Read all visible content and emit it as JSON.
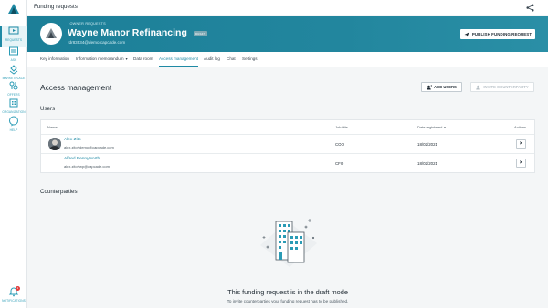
{
  "topbar": {
    "title": "Funding requests"
  },
  "sidebar": {
    "items": [
      {
        "label": "Requests",
        "icon": "requests-icon",
        "active": true
      },
      {
        "label": "Ask",
        "icon": "ask-icon"
      },
      {
        "label": "Marketplace",
        "icon": "marketplace-icon"
      },
      {
        "label": "Offers",
        "icon": "offers-icon"
      },
      {
        "label": "Organization",
        "icon": "organization-icon"
      },
      {
        "label": "Help",
        "icon": "help-icon"
      },
      {
        "label": "Notifications",
        "icon": "bell-icon",
        "badge": "1"
      }
    ]
  },
  "hero": {
    "breadcrumb": "/ OWNER REQUESTS",
    "company": "Wayne Manor Refinancing",
    "status": "DRAFT",
    "email": "rdr83534@demo.capcade.com",
    "publish_label": "PUBLISH FUNDING REQUEST"
  },
  "tabs": [
    {
      "label": "Key information"
    },
    {
      "label": "Information memorandum"
    },
    {
      "label": "Data room"
    },
    {
      "label": "Access management",
      "active": true
    },
    {
      "label": "Audit log"
    },
    {
      "label": "Chat"
    },
    {
      "label": "Settings"
    }
  ],
  "main": {
    "title": "Access management",
    "add_users_label": "ADD USERS",
    "invite_label": "INVITE COUNTERPARTY",
    "users_title": "Users",
    "columns": {
      "name": "Name",
      "job": "Job title",
      "date": "Date registered",
      "actions": "Actions"
    },
    "users": [
      {
        "name": "Alex Zito",
        "email": "alex.zito+demo@capcade.com",
        "job": "COO",
        "date": "18/02/2021",
        "has_avatar": true
      },
      {
        "name": "Alfred Pennyworth",
        "email": "alex.zito+wp@capcade.com",
        "job": "CFO",
        "date": "18/02/2021",
        "has_avatar": false
      }
    ],
    "counterparties_title": "Counterparties",
    "empty_title": "This funding request is in the draft mode",
    "empty_text": "To invite counterparties your funding request has to be published."
  },
  "colors": {
    "accent": "#1f8aa5",
    "hero": "#1c7f98",
    "badge": "#e23b3b"
  }
}
